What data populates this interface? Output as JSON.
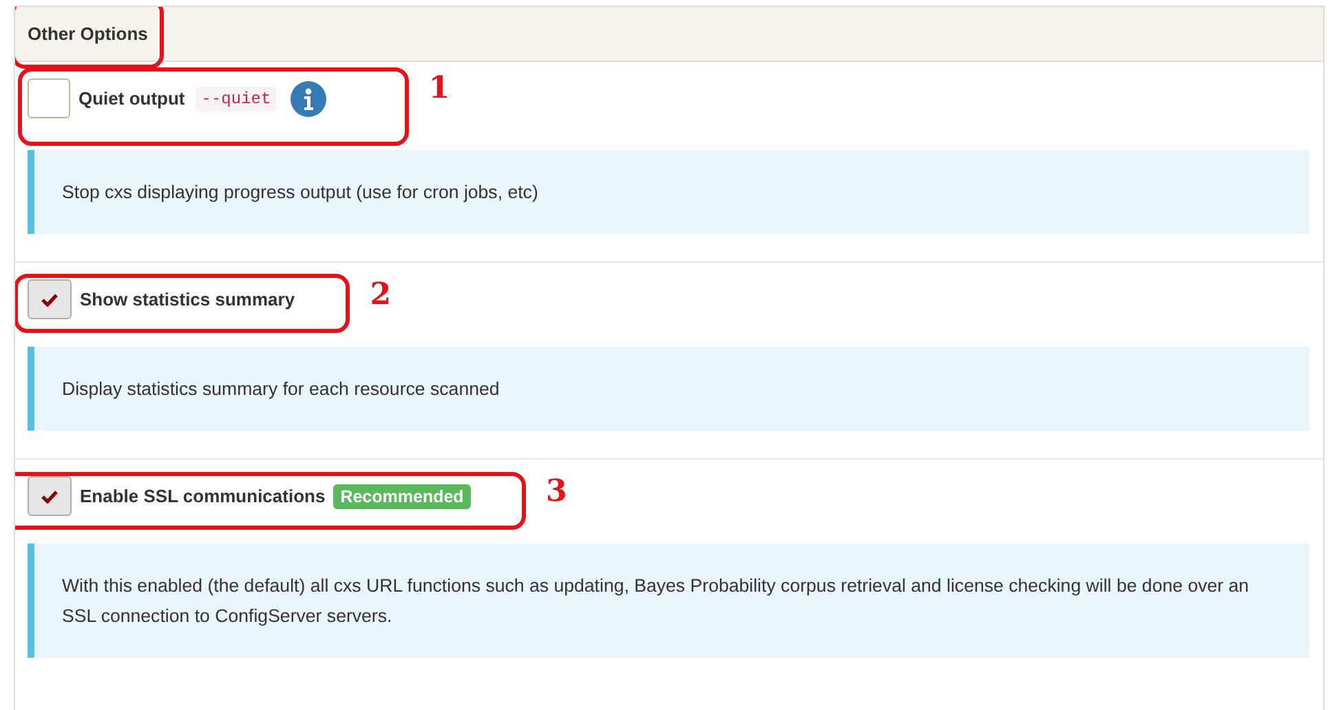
{
  "section": {
    "title": "Other Options",
    "annotated": true
  },
  "options": [
    {
      "label": "Quiet output",
      "flag": "--quiet",
      "info": true,
      "checked": false,
      "description": "Stop cxs displaying progress output (use for cron jobs, etc)",
      "annotation": "1"
    },
    {
      "label": "Show statistics summary",
      "checked": true,
      "description": "Display statistics summary for each resource scanned",
      "annotation": "2"
    },
    {
      "label": "Enable SSL communications",
      "badge": "Recommended",
      "checked": true,
      "description": "With this enabled (the default) all cxs URL functions such as updating, Bayes Probability corpus retrieval and license checking will be done over an SSL connection to ConfigServer servers.",
      "annotation": "3"
    }
  ]
}
